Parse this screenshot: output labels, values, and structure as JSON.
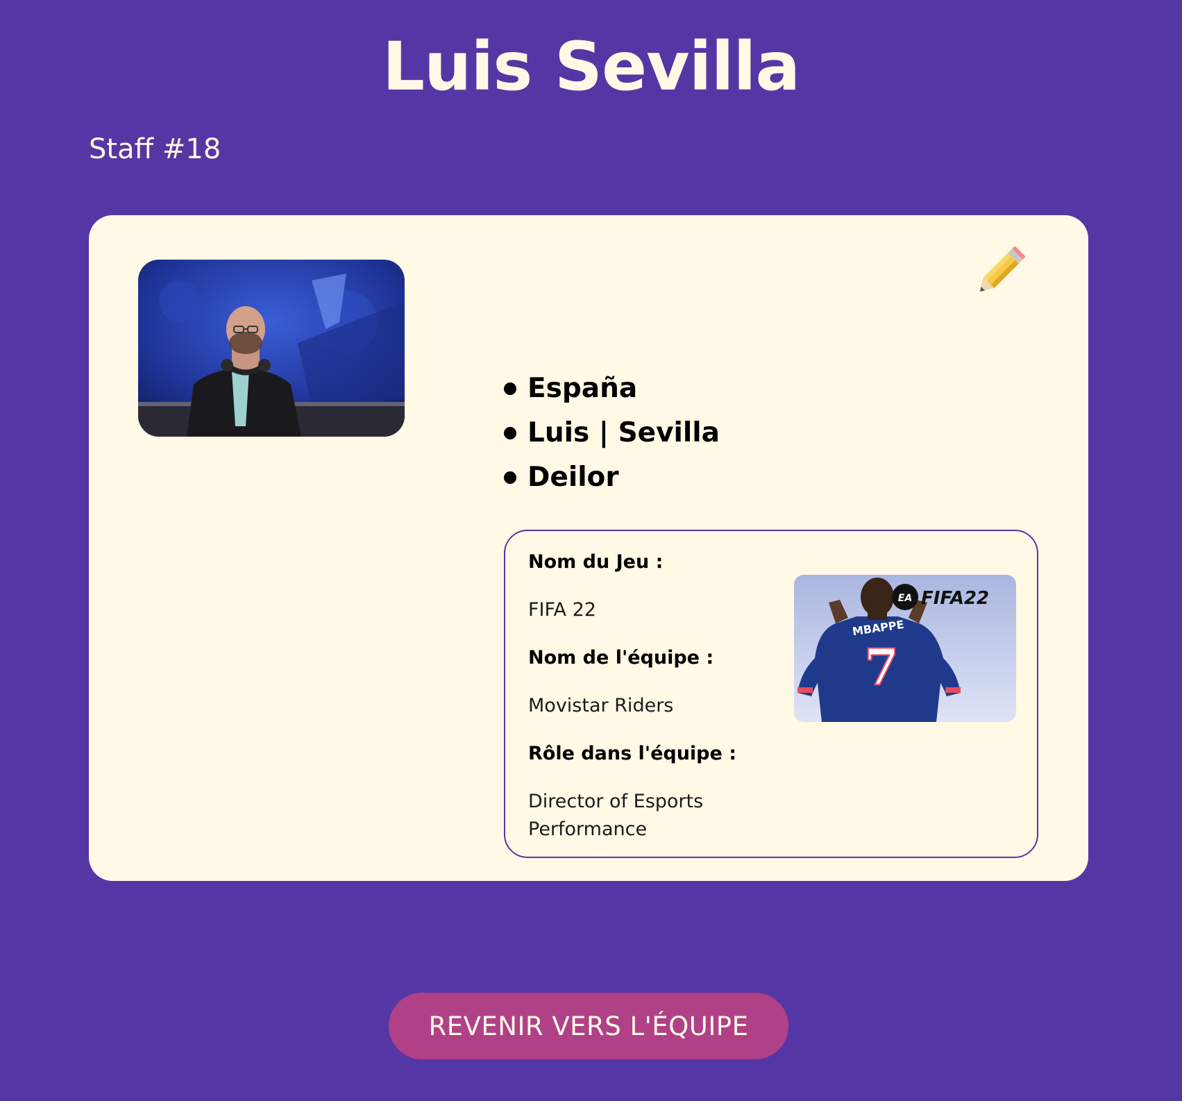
{
  "header": {
    "title": "Luis Sevilla",
    "subtitle": "Staff #18"
  },
  "profile": {
    "avatar_icon": "person-photo",
    "edit_icon": "pencil-icon",
    "details": [
      "España",
      "Luis | Sevilla",
      "Deilor"
    ]
  },
  "game": {
    "game_name_label": "Nom du Jeu :",
    "game_name": "FIFA 22",
    "team_name_label": "Nom de l'équipe :",
    "team_name": "Movistar Riders",
    "role_label": "Rôle dans l'équipe :",
    "role": "Director of Esports Performance",
    "cover": {
      "logo_text": "FIFA22",
      "brand_text": "EA",
      "jersey_name": "MBAPPE",
      "jersey_number": "7"
    }
  },
  "actions": {
    "back_label": "REVENIR VERS L'ÉQUIPE"
  },
  "colors": {
    "background": "#5536a5",
    "card": "#fff9e6",
    "button": "#b04187"
  }
}
